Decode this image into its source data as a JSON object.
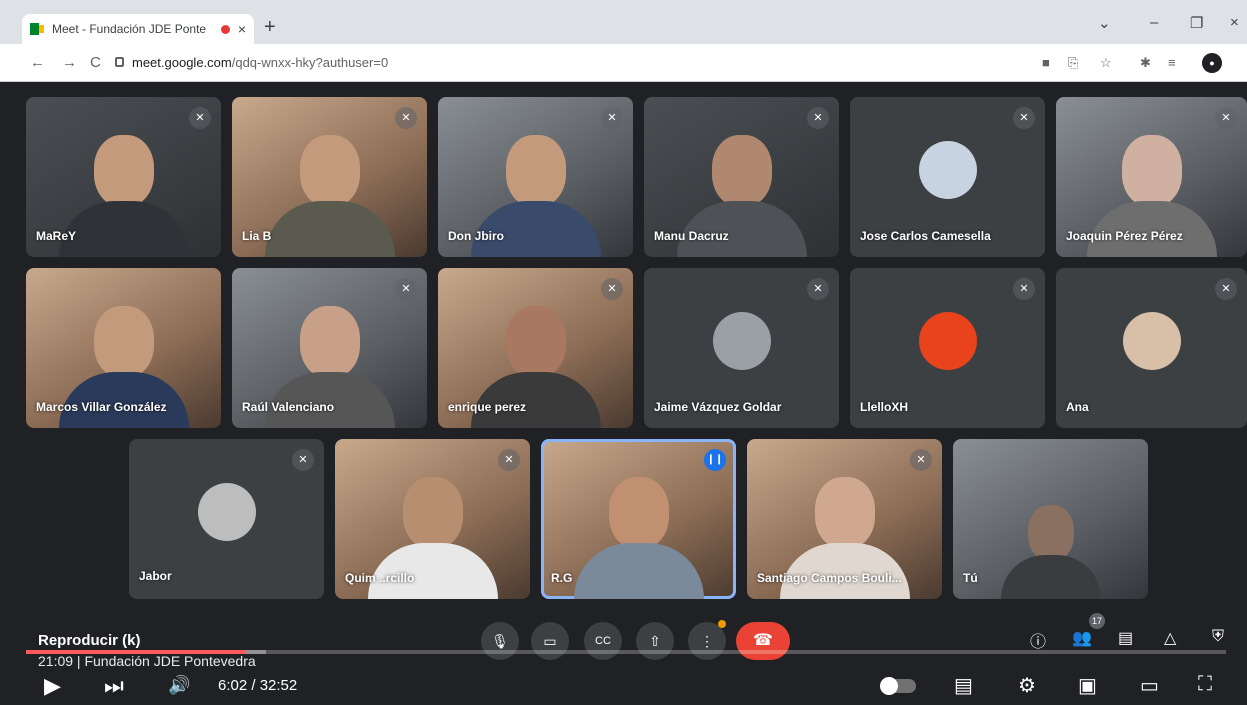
{
  "browser": {
    "tab_title": "Meet - Fundación JDE Ponte",
    "tab_close": "×",
    "new_tab": "+",
    "url_host": "meet.google.com",
    "url_path": "/qdq-wnxx-hky?authuser=0",
    "back": "←",
    "forward": "→",
    "reload": "C",
    "window_controls": {
      "dropdown": "⌄",
      "minimize": "–",
      "restore": "❐",
      "close": "×"
    },
    "extensions": [
      "■",
      "⎘",
      "☆",
      "✱",
      "≡"
    ],
    "profile_label": "●"
  },
  "participants_row1": [
    {
      "name": "MaReY",
      "style": "dark"
    },
    {
      "name": "Lia B",
      "style": "warm"
    },
    {
      "name": "Don Jbiro",
      "style": "cool"
    },
    {
      "name": "Manu Dacruz",
      "style": "dark"
    },
    {
      "name": "Jose Carlos Camesella",
      "style": "avatar"
    },
    {
      "name": "Joaquin Pérez Pérez",
      "style": "cool"
    }
  ],
  "participants_row2": [
    {
      "name": "Marcos Villar González",
      "style": "warm"
    },
    {
      "name": "Raúl Valenciano",
      "style": "cool"
    },
    {
      "name": "enrique perez",
      "style": "warm"
    },
    {
      "name": "Jaime Vázquez Goldar",
      "style": "avatar"
    },
    {
      "name": "LlelloXH",
      "style": "avatar"
    },
    {
      "name": "Ana",
      "style": "avatar"
    }
  ],
  "participants_row3": [
    {
      "name": "Jabor",
      "style": "avatar"
    },
    {
      "name": "Quim ..rcillo",
      "style": "warm"
    },
    {
      "name": "R.G",
      "style": "warm"
    },
    {
      "name": "Santiago Campos Bouli...",
      "style": "warm"
    },
    {
      "name": "Tú",
      "style": "cool"
    }
  ],
  "meet_bar": {
    "tooltip": "Reproducir (k)",
    "meeting_info": "21:09 | Fundación JDE Pontevedra",
    "people_count": "17",
    "icons": {
      "mic": "🎙",
      "camera": "▭",
      "captions": "CC",
      "present": "⇧",
      "more": "⋮",
      "hangup": "☎",
      "info": "ⓘ",
      "people": "👥",
      "chat": "▤",
      "activities": "△",
      "safety": "⛨"
    }
  },
  "youtube": {
    "time": "6:02 / 32:52",
    "progress": 0.183,
    "loaded": 0.2,
    "icons": {
      "play": "▶",
      "next": "⏭",
      "volume": "🔊",
      "subtitles": "▤",
      "settings": "⚙",
      "miniplayer": "▣",
      "theater": "▭",
      "fullscreen": "⛶"
    }
  },
  "colors": {
    "meet_bg": "#202124",
    "tile_bg": "#3c4043",
    "hangup": "#ea4335",
    "active_outline": "#8ab4f8",
    "progress": "#ff0000"
  }
}
